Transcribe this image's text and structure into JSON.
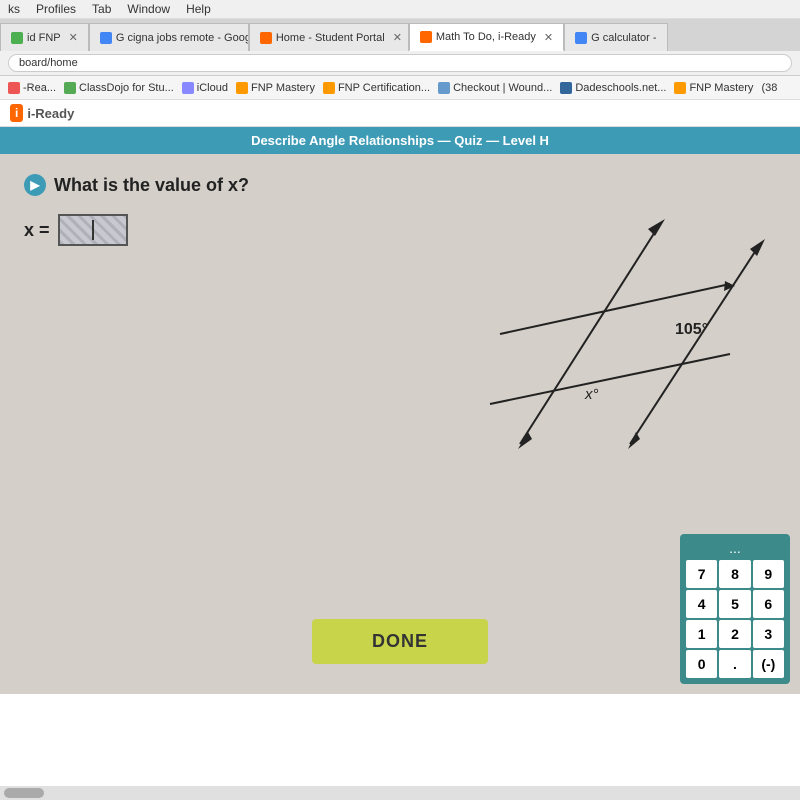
{
  "menu": {
    "items": [
      "ks",
      "Profiles",
      "Tab",
      "Window",
      "Help"
    ]
  },
  "tabs": [
    {
      "label": "id FNP",
      "active": false,
      "favicon": "default"
    },
    {
      "label": "G cigna jobs remote - Google Se...",
      "active": false,
      "favicon": "google"
    },
    {
      "label": "Home - Student Portal",
      "active": false,
      "favicon": "iready"
    },
    {
      "label": "Math To Do, i-Ready",
      "active": true,
      "favicon": "iready"
    },
    {
      "label": "G calculator -",
      "active": false,
      "favicon": "google"
    }
  ],
  "address": {
    "url": "board/home"
  },
  "bookmarks": [
    {
      "label": "-Rea..."
    },
    {
      "label": "ClassDojo for Stu..."
    },
    {
      "label": "iCloud"
    },
    {
      "label": "FNP Mastery"
    },
    {
      "label": "FNP Certification..."
    },
    {
      "label": "Checkout | Wound..."
    },
    {
      "label": "Dadeschools.net..."
    },
    {
      "label": "FNP Mastery"
    },
    {
      "label": "(38"
    }
  ],
  "iready": {
    "logo_text": "i-Ready",
    "quiz_title": "Describe Angle Relationships — Quiz — Level H",
    "question": {
      "prompt": "What is the value of x?",
      "equation_label": "x =",
      "angle_label": "105°",
      "angle_x_label": "x°"
    }
  },
  "calculator": {
    "dots": "...",
    "buttons": [
      "7",
      "8",
      "9",
      "4",
      "5",
      "6",
      "1",
      "2",
      "3",
      "0",
      ".",
      "(-)"
    ]
  },
  "done_button": {
    "label": "DONE"
  },
  "scrollbar": {}
}
